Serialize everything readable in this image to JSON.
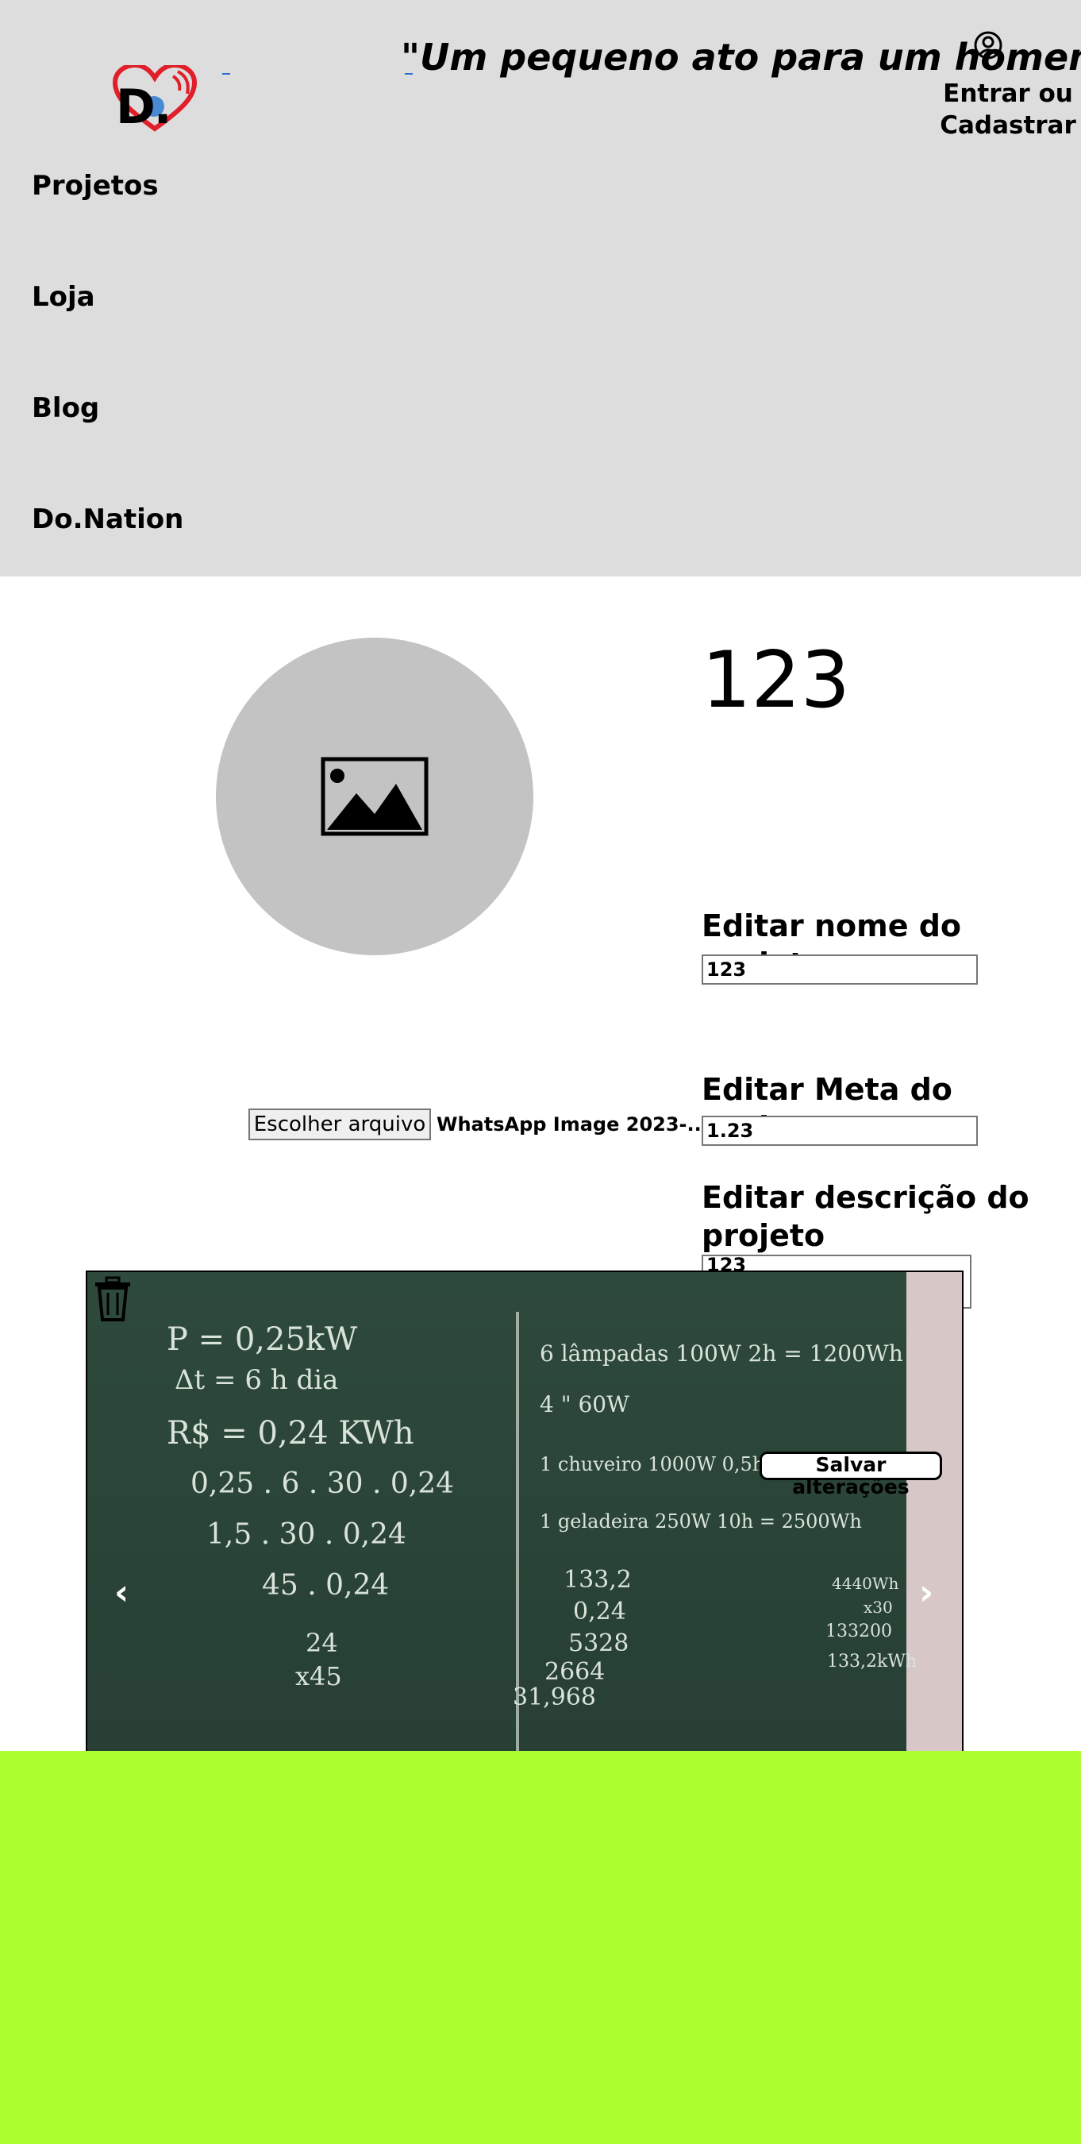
{
  "header": {
    "quote": "\"Um pequeno ato para um homem, mas um grande passo para o futuro\"",
    "login_text": "Entrar ou Cadastrar",
    "login_icon": "user-circle-icon",
    "logo_text": "D."
  },
  "nav": {
    "items": [
      {
        "label": "Projetos"
      },
      {
        "label": "Loja"
      },
      {
        "label": "Blog"
      },
      {
        "label": "Do.Nation"
      }
    ]
  },
  "project": {
    "number": "123",
    "image_icon": "image-placeholder-icon"
  },
  "form": {
    "name_label": "Editar nome do projeto",
    "name_value": "123",
    "goal_label": "Editar Meta do projeto",
    "goal_value": "1.23",
    "description_label": "Editar descrição do projeto",
    "description_value": "123",
    "file_button": "Escolher arquivo",
    "file_name": "WhatsApp Image 2023-...",
    "save_button": "Salvar alterações"
  },
  "carousel": {
    "prev_label": "‹",
    "next_label": "›",
    "delete_icon": "trash-icon",
    "chalk_left": [
      "P = 0,25kW",
      "Δt = 6 h dia",
      "R$ = 0,24 KWh",
      "0,25 . 6 . 30 . 0,24",
      "1,5 . 30 . 0,24",
      "45 . 0,24",
      "24",
      "x45"
    ],
    "chalk_right": [
      "6 lâmpadas 100W 2h = 1200Wh",
      "4 \" 60W",
      "1 chuveiro 1000W 0,5h = 500Wh",
      "1 geladeira 250W 10h = 2500Wh",
      "133,2",
      "0,24",
      "5328",
      "2664",
      "31,968",
      "4440Wh",
      "x30",
      "133200",
      "133,2kWh"
    ]
  },
  "colors": {
    "header_bg": "#dddddd",
    "footer_bg": "#adff2f",
    "circle_bg": "#c3c3c3"
  }
}
